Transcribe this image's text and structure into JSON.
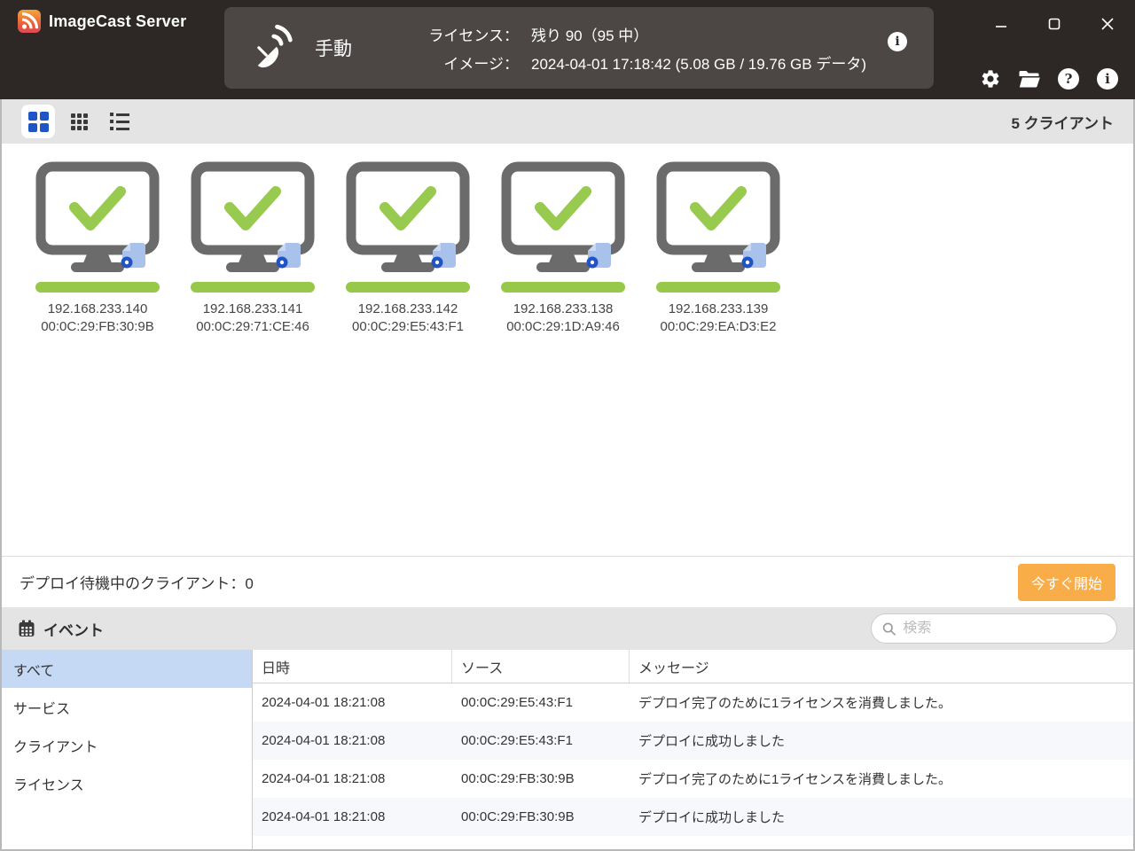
{
  "app": {
    "title": "ImageCast Server"
  },
  "header": {
    "mode_label": "手動",
    "license_label": "ライセンス：",
    "license_value": "残り 90（95 中）",
    "image_label": "イメージ：",
    "image_value": "2024-04-01 17:18:42 (5.08 GB / 19.76 GB データ)"
  },
  "icons": {
    "logo": "rss-broadcast-icon",
    "mode": "satellite-dish-icon",
    "titlebar_actions": [
      "settings-gear-icon",
      "open-folder-icon",
      "help-icon",
      "info-icon"
    ],
    "view_modes": [
      "large-grid-view-icon",
      "small-grid-view-icon",
      "list-view-icon"
    ],
    "event_title": "calendar-icon",
    "search": "magnifier-icon",
    "client_badge": "image-certificate-icon",
    "client_status": "green-checkmark"
  },
  "toolbar": {
    "client_count": "5 クライアント"
  },
  "clients": [
    {
      "ip": "192.168.233.140",
      "mac": "00:0C:29:FB:30:9B",
      "progress_percent": 100,
      "status": "success"
    },
    {
      "ip": "192.168.233.141",
      "mac": "00:0C:29:71:CE:46",
      "progress_percent": 100,
      "status": "success"
    },
    {
      "ip": "192.168.233.142",
      "mac": "00:0C:29:E5:43:F1",
      "progress_percent": 100,
      "status": "success"
    },
    {
      "ip": "192.168.233.138",
      "mac": "00:0C:29:1D:A9:46",
      "progress_percent": 100,
      "status": "success"
    },
    {
      "ip": "192.168.233.139",
      "mac": "00:0C:29:EA:D3:E2",
      "progress_percent": 100,
      "status": "success"
    }
  ],
  "deploy": {
    "waiting_label": "デプロイ待機中のクライアント：0",
    "start_button": "今すぐ開始"
  },
  "events": {
    "title": "イベント",
    "search_placeholder": "検索",
    "filters": [
      {
        "label": "すべて",
        "selected": true
      },
      {
        "label": "サービス",
        "selected": false
      },
      {
        "label": "クライアント",
        "selected": false
      },
      {
        "label": "ライセンス",
        "selected": false
      }
    ],
    "columns": [
      "日時",
      "ソース",
      "メッセージ"
    ],
    "rows": [
      {
        "time": "2024-04-01 18:21:08",
        "source": "00:0C:29:E5:43:F1",
        "message": "デプロイ完了のために1ライセンスを消費しました。"
      },
      {
        "time": "2024-04-01 18:21:08",
        "source": "00:0C:29:E5:43:F1",
        "message": "デプロイに成功しました"
      },
      {
        "time": "2024-04-01 18:21:08",
        "source": "00:0C:29:FB:30:9B",
        "message": "デプロイ完了のために1ライセンスを消費しました。"
      },
      {
        "time": "2024-04-01 18:21:08",
        "source": "00:0C:29:FB:30:9B",
        "message": "デプロイに成功しました"
      }
    ]
  },
  "colors": {
    "titlebar_bg": "#2d2825",
    "mode_panel_bg": "#4c4745",
    "accent_blue": "#1e56c8",
    "status_green": "#97c84a",
    "selected_filter_bg": "#c5d9f4",
    "start_button_orange": "#f8ad49",
    "toolbar_bg": "#e4e4e4",
    "alt_row_bg": "#f6f8fc"
  }
}
